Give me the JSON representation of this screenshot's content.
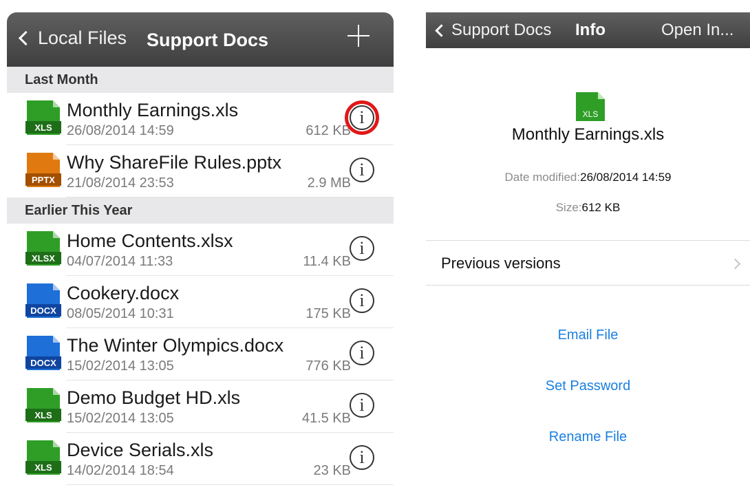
{
  "left": {
    "nav": {
      "back_label": "Local Files",
      "title": "Support Docs"
    },
    "sections": [
      {
        "header": "Last Month",
        "files": [
          {
            "name": "Monthly Earnings.xls",
            "date": "26/08/2014 14:59",
            "size": "612 KB",
            "type": "XLS",
            "color": "#2f9e27",
            "dark": "#1e6e18"
          },
          {
            "name": "Why ShareFile Rules.pptx",
            "date": "21/08/2014 23:53",
            "size": "2.9 MB",
            "type": "PPTX",
            "color": "#e07a10",
            "dark": "#a24f00"
          }
        ]
      },
      {
        "header": "Earlier This Year",
        "files": [
          {
            "name": "Home Contents.xlsx",
            "date": "04/07/2014 11:33",
            "size": "11.4 KB",
            "type": "XLSX",
            "color": "#2f9e27",
            "dark": "#1e6e18"
          },
          {
            "name": "Cookery.docx",
            "date": "08/05/2014 10:31",
            "size": "175 KB",
            "type": "DOCX",
            "color": "#1e6fd8",
            "dark": "#0f45a0"
          },
          {
            "name": "The Winter Olympics.docx",
            "date": "15/02/2014 13:05",
            "size": "776 KB",
            "type": "DOCX",
            "color": "#1e6fd8",
            "dark": "#0f45a0"
          },
          {
            "name": "Demo Budget HD.xls",
            "date": "15/02/2014 13:05",
            "size": "41.5 KB",
            "type": "XLS",
            "color": "#2f9e27",
            "dark": "#1e6e18"
          },
          {
            "name": "Device Serials.xls",
            "date": "14/02/2014 18:54",
            "size": "23 KB",
            "type": "XLS",
            "color": "#2f9e27",
            "dark": "#1e6e18"
          }
        ]
      }
    ],
    "info_glyph": "i",
    "highlight_color": "#e01818"
  },
  "right": {
    "nav": {
      "back_label": "Support Docs",
      "title": "Info",
      "open_in": "Open In..."
    },
    "file": {
      "name": "Monthly Earnings.xls",
      "type": "XLS",
      "date_label": "Date modified:",
      "date": "26/08/2014 14:59",
      "size_label": "Size:",
      "size": "612 KB"
    },
    "previous_versions": "Previous versions",
    "actions": {
      "email": "Email File",
      "password": "Set Password",
      "rename": "Rename File"
    }
  },
  "colors": {
    "accent": "#1a7fe0",
    "navbar": "#4a4a4a",
    "section_bg": "#e8e8ea",
    "xls": "#2f9e27",
    "pptx": "#e07a10",
    "docx": "#1e6fd8"
  }
}
